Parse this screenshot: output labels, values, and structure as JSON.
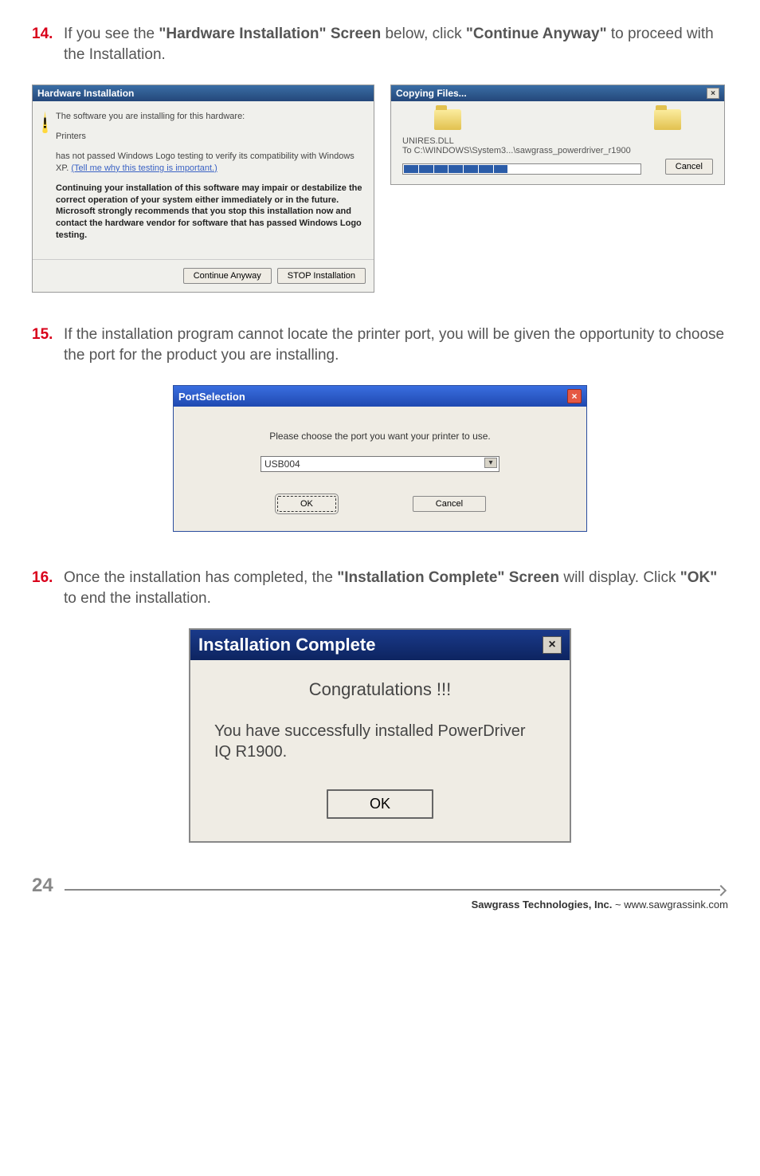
{
  "steps": {
    "s14": {
      "num": "14.",
      "pre": "If you see the ",
      "b1": "\"Hardware Installation\" Screen",
      "mid": " below, click ",
      "b2": "\"Continue Anyway\"",
      "post": " to proceed with the Installation."
    },
    "s15": {
      "num": "15.",
      "text": "If the installation program cannot locate the printer port, you will be given the opportunity to choose the port for the product you are installing."
    },
    "s16": {
      "num": "16.",
      "pre": "Once the installation has completed, the ",
      "b1": "\"Installation Complete\" Screen",
      "mid": " will display.  Click ",
      "b2": "\"OK\"",
      "post": " to end the installation."
    }
  },
  "hw": {
    "title": "Hardware Installation",
    "line1": "The software you are installing for this hardware:",
    "line2": "Printers",
    "line3a": "has not passed Windows Logo testing to verify its compatibility with Windows XP. ",
    "link": "(Tell me why this testing is important.)",
    "bold": "Continuing your installation of this software may impair or destabilize the correct operation of your system either immediately or in the future. Microsoft strongly recommends that you stop this installation now and contact the hardware vendor for software that has passed Windows Logo testing.",
    "btn_continue": "Continue Anyway",
    "btn_stop": "STOP Installation"
  },
  "copy": {
    "title": "Copying Files...",
    "file": "UNIRES.DLL",
    "dest": "To C:\\WINDOWS\\System3...\\sawgrass_powerdriver_r1900",
    "cancel": "Cancel"
  },
  "port": {
    "title": "PortSelection",
    "prompt": "Please choose the port you want your printer to use.",
    "selected": "USB004",
    "ok": "OK",
    "cancel": "Cancel"
  },
  "complete": {
    "title": "Installation Complete",
    "congrats": "Congratulations !!!",
    "msg": "You have successfully installed PowerDriver IQ R1900.",
    "ok": "OK"
  },
  "footer": {
    "page": "24",
    "company": "Sawgrass Technologies, Inc.",
    "sep": " ~ ",
    "url": "www.sawgrassink.com"
  }
}
